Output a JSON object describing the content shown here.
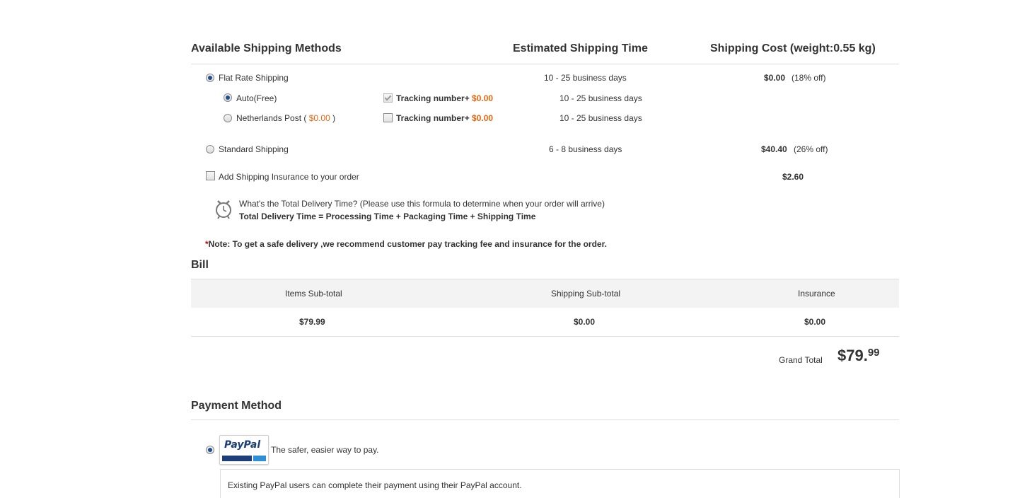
{
  "shipping": {
    "header_methods": "Available Shipping Methods",
    "header_time": "Estimated Shipping Time",
    "header_cost": "Shipping Cost (weight:0.55 kg)",
    "flat_rate": {
      "label": "Flat Rate Shipping",
      "time": "10 - 25 business days",
      "cost": "$0.00",
      "discount": "(18% off)",
      "selected": true,
      "options": [
        {
          "label": "Auto(Free)",
          "selected": true,
          "tracking_label": "Tracking number+",
          "tracking_price": "$0.00",
          "tracking_checked": true,
          "time": "10 - 25 business days"
        },
        {
          "label_prefix": "Netherlands Post (",
          "price": "$0.00",
          "label_suffix": ")",
          "selected": false,
          "tracking_label": "Tracking number+",
          "tracking_price": "$0.00",
          "tracking_checked": false,
          "time": "10 - 25 business days"
        }
      ]
    },
    "standard": {
      "label": "Standard Shipping",
      "time": "6 - 8 business days",
      "cost": "$40.40",
      "discount": "(26% off)",
      "selected": false
    },
    "insurance": {
      "label": "Add Shipping Insurance to your order",
      "cost": "$2.60",
      "checked": false
    },
    "delivery_info": {
      "question": "What's the Total Delivery Time? (Please use this formula to determine when your order will arrive)",
      "formula": "Total Delivery Time = Processing Time + Packaging Time + Shipping Time"
    },
    "note": {
      "asterisk": "*",
      "text": "Note: To get a safe delivery ,we recommend customer pay tracking fee and insurance for the order."
    }
  },
  "bill": {
    "title": "Bill",
    "columns": [
      "Items Sub-total",
      "Shipping Sub-total",
      "Insurance"
    ],
    "values": [
      "$79.99",
      "$0.00",
      "$0.00"
    ],
    "grand_total_label": "Grand Total",
    "grand_total_main": "$79.",
    "grand_total_cents": "99"
  },
  "payment": {
    "title": "Payment Method",
    "paypal_logo_text": "PayPal",
    "paypal_tagline": "The safer, easier way to pay.",
    "paypal_selected": true,
    "paypal_description": "Existing PayPal users can complete their payment using their PayPal account."
  },
  "colors": {
    "accent_orange": "#e8640c",
    "radio_dot": "#1f4e8c",
    "paypal_dark": "#1c3f7a",
    "paypal_light": "#2e8fd6",
    "note_asterisk": "#cc0000"
  },
  "icons": {
    "delivery_time": "alarm-clock-icon"
  }
}
